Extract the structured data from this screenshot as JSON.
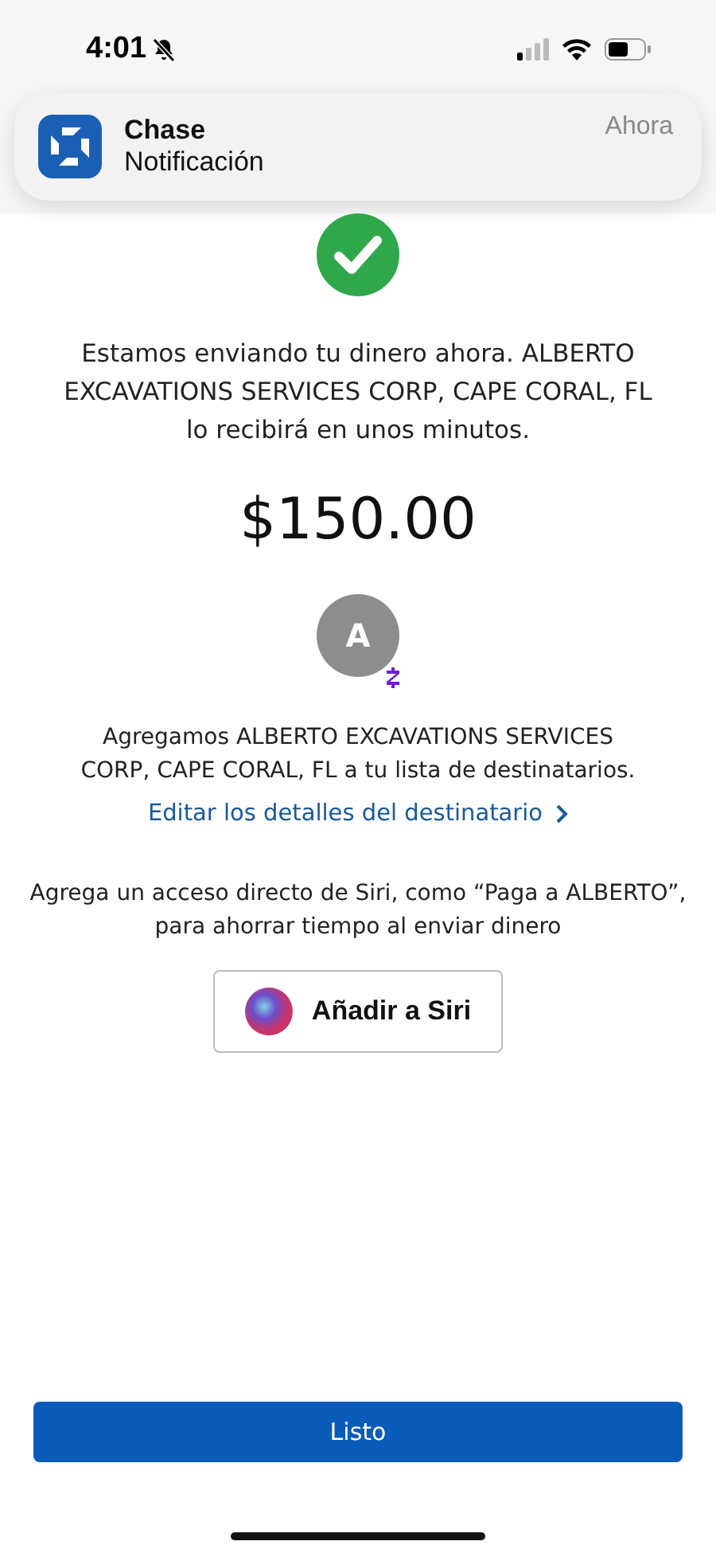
{
  "status_bar": {
    "time": "4:01",
    "muted": true
  },
  "notification": {
    "app": "Chase",
    "message": "Notificación",
    "time": "Ahora"
  },
  "confirmation": {
    "message": "Estamos enviando tu dinero ahora. ALBERTO EXCAVATIONS SERVICES CORP, CAPE CORAL, FL lo recibirá en unos minutos.",
    "amount": "$150.00"
  },
  "recipient": {
    "initial": "A",
    "added_message": "Agregamos ALBERTO EXCAVATIONS SERVICES CORP, CAPE CORAL, FL a tu lista de destinatarios.",
    "edit_link": "Editar los detalles del destinatario"
  },
  "siri": {
    "message": "Agrega un acceso directo de Siri, como “Paga a ALBERTO”, para ahorrar tiempo al enviar dinero",
    "button": "Añadir a Siri"
  },
  "done_button": "Listo"
}
